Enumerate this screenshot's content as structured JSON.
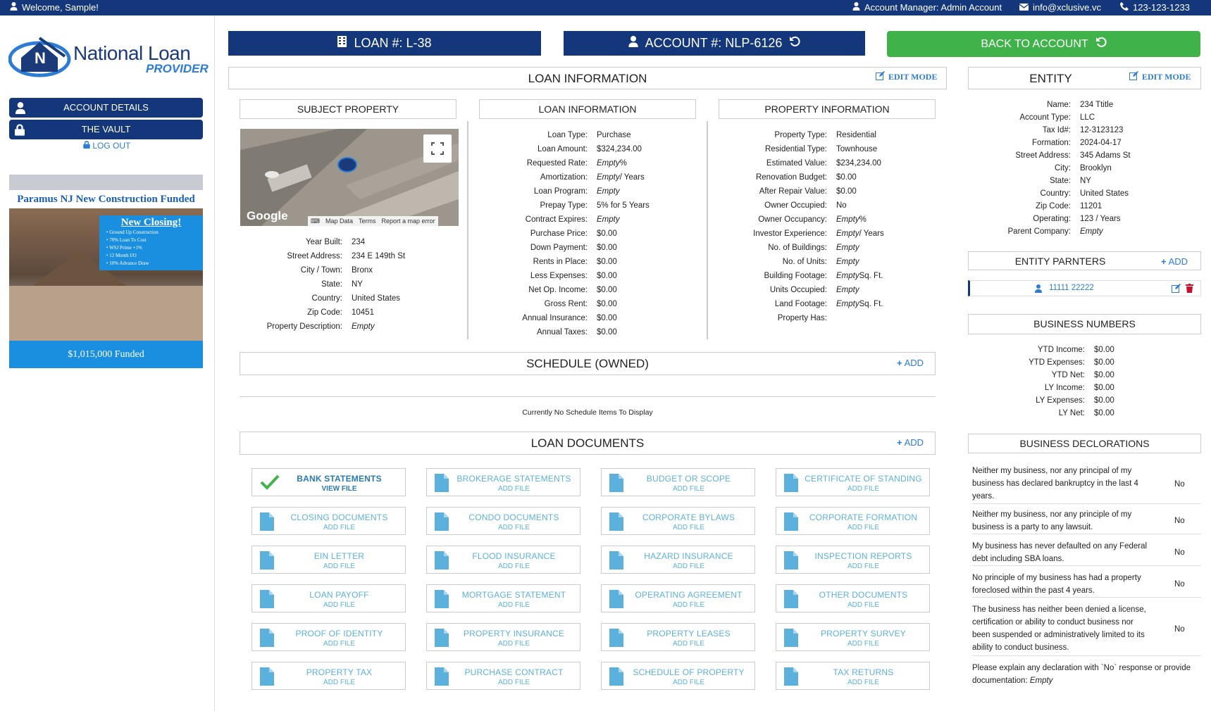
{
  "topbar": {
    "welcome": "Welcome, Sample!",
    "manager": "Account Manager: Admin Account",
    "email": "info@xclusive.vc",
    "phone": "123-123-1233"
  },
  "brand": {
    "title": "National Loan",
    "subtitle": "PROVIDER",
    "letter": "N"
  },
  "sidebar": {
    "account_details": "ACCOUNT DETAILS",
    "vault": "THE VAULT",
    "logout": "LOG OUT"
  },
  "ad": {
    "headline": "Paramus NJ New Construction Funded",
    "new_closing": "New Closing!",
    "bullets": [
      "Ground Up Construction",
      "70% Loan To Cost",
      "WSJ Prime +1%",
      "12 Month I/O",
      "10% Advance Draw"
    ],
    "funded": "$1,015,000 Funded"
  },
  "header": {
    "loan": "LOAN #: L-38",
    "account": "ACCOUNT #: NLP-6126",
    "back": "BACK TO ACCOUNT"
  },
  "loan_info": {
    "title": "LOAN INFORMATION",
    "edit": "EDIT MODE",
    "subject_property": {
      "title": "SUBJECT PROPERTY",
      "map_labels": [
        "Map Data",
        "Terms",
        "Report a map error"
      ],
      "google": "Google",
      "rows": [
        {
          "k": "Year Built:",
          "v": "234"
        },
        {
          "k": "Street Address:",
          "v": "234 E 149th St"
        },
        {
          "k": "City / Town:",
          "v": "Bronx"
        },
        {
          "k": "State:",
          "v": "NY"
        },
        {
          "k": "Country:",
          "v": "United States"
        },
        {
          "k": "Zip Code:",
          "v": "10451"
        },
        {
          "k": "Property Description:",
          "v": "Empty"
        }
      ]
    },
    "loan_information": {
      "title": "LOAN INFORMATION",
      "rows": [
        {
          "k": "Loan Type:",
          "v": "Purchase"
        },
        {
          "k": "Loan Amount:",
          "v": "$324,234.00"
        },
        {
          "k": "Requested Rate:",
          "v": "Empty",
          "s": " %"
        },
        {
          "k": "Amortization:",
          "v": "Empty",
          "s": " / Years"
        },
        {
          "k": "Loan Program:",
          "v": "Empty"
        },
        {
          "k": "Prepay Type:",
          "v": "5% for 5 Years"
        },
        {
          "k": "Contract Expires:",
          "v": "Empty"
        },
        {
          "k": "Purchase Price:",
          "v": "$0.00"
        },
        {
          "k": "Down Payment:",
          "v": "$0.00"
        },
        {
          "k": "Rents in Place:",
          "v": "$0.00"
        },
        {
          "k": "Less Expenses:",
          "v": "$0.00"
        },
        {
          "k": "Net Op. Income:",
          "v": "$0.00"
        },
        {
          "k": "Gross Rent:",
          "v": "$0.00"
        },
        {
          "k": "Annual Insurance:",
          "v": "$0.00"
        },
        {
          "k": "Annual Taxes:",
          "v": "$0.00"
        }
      ]
    },
    "property_information": {
      "title": "PROPERTY INFORMATION",
      "rows": [
        {
          "k": "Property Type:",
          "v": "Residential"
        },
        {
          "k": "Residential Type:",
          "v": "Townhouse"
        },
        {
          "k": "Estimated Value:",
          "v": "$234,234.00"
        },
        {
          "k": "Renovation Budget:",
          "v": "$0.00"
        },
        {
          "k": "After Repair Value:",
          "v": "$0.00"
        },
        {
          "k": "Owner Occupied:",
          "v": "No"
        },
        {
          "k": "Owner Occupancy:",
          "v": "Empty",
          "s": " %"
        },
        {
          "k": "Investor Experience:",
          "v": "Empty",
          "s": " / Years"
        },
        {
          "k": "No. of Buildings:",
          "v": "Empty"
        },
        {
          "k": "No. of Units:",
          "v": "Empty"
        },
        {
          "k": "Building Footage:",
          "v": "Empty",
          "s": " Sq. Ft."
        },
        {
          "k": "Units Occupied:",
          "v": "Empty"
        },
        {
          "k": "Land Footage:",
          "v": "Empty",
          "s": " Sq. Ft."
        },
        {
          "k": "Property Has:",
          "v": ""
        }
      ]
    },
    "schedule": {
      "title": "SCHEDULE (OWNED)",
      "add": "ADD",
      "empty": "Currently No Schedule Items To Display"
    },
    "documents": {
      "title": "LOAN DOCUMENTS",
      "add": "ADD",
      "items": [
        {
          "t": "BANK STATEMENTS",
          "s": "VIEW FILE"
        },
        {
          "t": "BROKERAGE STATEMENTS",
          "s": "ADD FILE"
        },
        {
          "t": "BUDGET OR SCOPE",
          "s": "ADD FILE"
        },
        {
          "t": "CERTIFICATE OF STANDING",
          "s": "ADD FILE"
        },
        {
          "t": "CLOSING DOCUMENTS",
          "s": "ADD FILE"
        },
        {
          "t": "CONDO DOCUMENTS",
          "s": "ADD FILE"
        },
        {
          "t": "CORPORATE BYLAWS",
          "s": "ADD FILE"
        },
        {
          "t": "CORPORATE FORMATION",
          "s": "ADD FILE"
        },
        {
          "t": "EIN LETTER",
          "s": "ADD FILE"
        },
        {
          "t": "FLOOD INSURANCE",
          "s": "ADD FILE"
        },
        {
          "t": "HAZARD INSURANCE",
          "s": "ADD FILE"
        },
        {
          "t": "INSPECTION REPORTS",
          "s": "ADD FILE"
        },
        {
          "t": "LOAN PAYOFF",
          "s": "ADD FILE"
        },
        {
          "t": "MORTGAGE STATEMENT",
          "s": "ADD FILE"
        },
        {
          "t": "OPERATING AGREEMENT",
          "s": "ADD FILE"
        },
        {
          "t": "OTHER DOCUMENTS",
          "s": "ADD FILE"
        },
        {
          "t": "PROOF OF IDENTITY",
          "s": "ADD FILE"
        },
        {
          "t": "PROPERTY INSURANCE",
          "s": "ADD FILE"
        },
        {
          "t": "PROPERTY LEASES",
          "s": "ADD FILE"
        },
        {
          "t": "PROPERTY SURVEY",
          "s": "ADD FILE"
        },
        {
          "t": "PROPERTY TAX",
          "s": "ADD FILE"
        },
        {
          "t": "PURCHASE CONTRACT",
          "s": "ADD FILE"
        },
        {
          "t": "SCHEDULE OF PROPERTY",
          "s": "ADD FILE"
        },
        {
          "t": "TAX RETURNS",
          "s": "ADD FILE"
        }
      ]
    }
  },
  "entity": {
    "title": "ENTITY",
    "edit": "EDIT MODE",
    "rows": [
      {
        "k": "Name:",
        "v": "234 Ttitle"
      },
      {
        "k": "Account Type:",
        "v": "LLC"
      },
      {
        "k": "Tax Id#:",
        "v": "12-3123123"
      },
      {
        "k": "Formation:",
        "v": "2024-04-17"
      },
      {
        "k": "Street Address:",
        "v": "345 Adams St"
      },
      {
        "k": "City:",
        "v": "Brooklyn"
      },
      {
        "k": "State:",
        "v": "NY"
      },
      {
        "k": "Country:",
        "v": "United States"
      },
      {
        "k": "Zip Code:",
        "v": "11201"
      },
      {
        "k": "Operating:",
        "v": "123 / Years"
      },
      {
        "k": "Parent Company:",
        "v": "Empty"
      }
    ],
    "partners_title": "ENTITY PARNTERS",
    "partners_add": "ADD",
    "partner": "11111 22222",
    "numbers_title": "BUSINESS NUMBERS",
    "numbers": [
      {
        "k": "YTD Income:",
        "v": "$0.00"
      },
      {
        "k": "YTD Expenses:",
        "v": "$0.00"
      },
      {
        "k": "YTD Net:",
        "v": "$0.00"
      },
      {
        "k": "LY Income:",
        "v": "$0.00"
      },
      {
        "k": "LY Expenses:",
        "v": "$0.00"
      },
      {
        "k": "LY Net:",
        "v": "$0.00"
      }
    ],
    "declarations_title": "BUSINESS DECLORATIONS",
    "declarations": [
      {
        "q": "Neither my business, nor any principal of my business has declared bankruptcy in the last 4 years.",
        "a": "No"
      },
      {
        "q": "Neither my business, nor any principle of my business is a party to any lawsuit.",
        "a": "No"
      },
      {
        "q": "My business has never defaulted on any Federal debt including SBA loans.",
        "a": "No"
      },
      {
        "q": "No principle of my business has had a property foreclosed within the past 4 years.",
        "a": "No"
      },
      {
        "q": "The business has neither been denied a license, certification or ability to conduct business nor been suspended or administratively limited to its ability to conduct business.",
        "a": "No"
      }
    ],
    "explain": "Please explain any declaration with `No` response or provide documentation:",
    "explain_value": "Empty"
  },
  "colors": {
    "navy": "#13377a",
    "green": "#3fb34a",
    "link": "#2c7cd6",
    "doc": "#5cb1dc"
  }
}
